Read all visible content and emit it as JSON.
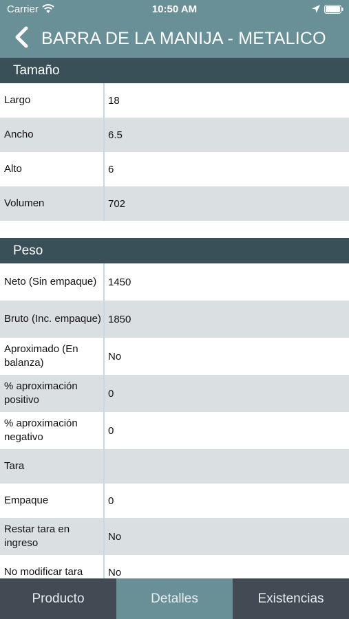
{
  "status_bar": {
    "carrier": "Carrier",
    "time": "10:50 AM"
  },
  "nav": {
    "title": "BARRA DE LA MANIJA - METALICO"
  },
  "sections": [
    {
      "title": "Tamaño",
      "rows": [
        {
          "label": "Largo",
          "value": "18"
        },
        {
          "label": "Ancho",
          "value": "6.5"
        },
        {
          "label": "Alto",
          "value": "6"
        },
        {
          "label": "Volumen",
          "value": "702"
        }
      ]
    },
    {
      "title": "Peso",
      "rows": [
        {
          "label": "Neto (Sin empaque)",
          "value": "1450"
        },
        {
          "label": "Bruto (Inc. empaque)",
          "value": "1850"
        },
        {
          "label": "Aproximado (En balanza)",
          "value": "No"
        },
        {
          "label": "% aproximación positivo",
          "value": "0"
        },
        {
          "label": "% aproximación negativo",
          "value": "0"
        },
        {
          "label": "Tara",
          "value": ""
        },
        {
          "label": "Empaque",
          "value": "0"
        },
        {
          "label": "Restar tara en ingreso",
          "value": "No"
        },
        {
          "label": "No modificar tara",
          "value": "No"
        }
      ]
    }
  ],
  "tabs": [
    {
      "label": "Producto",
      "active": false
    },
    {
      "label": "Detalles",
      "active": true
    },
    {
      "label": "Existencias",
      "active": false
    }
  ],
  "colors": {
    "nav_background": "#698f97",
    "section_header": "#395059",
    "row_alt": "#dadfe2",
    "tab_bar": "#424b54",
    "tab_active": "#698f97"
  }
}
